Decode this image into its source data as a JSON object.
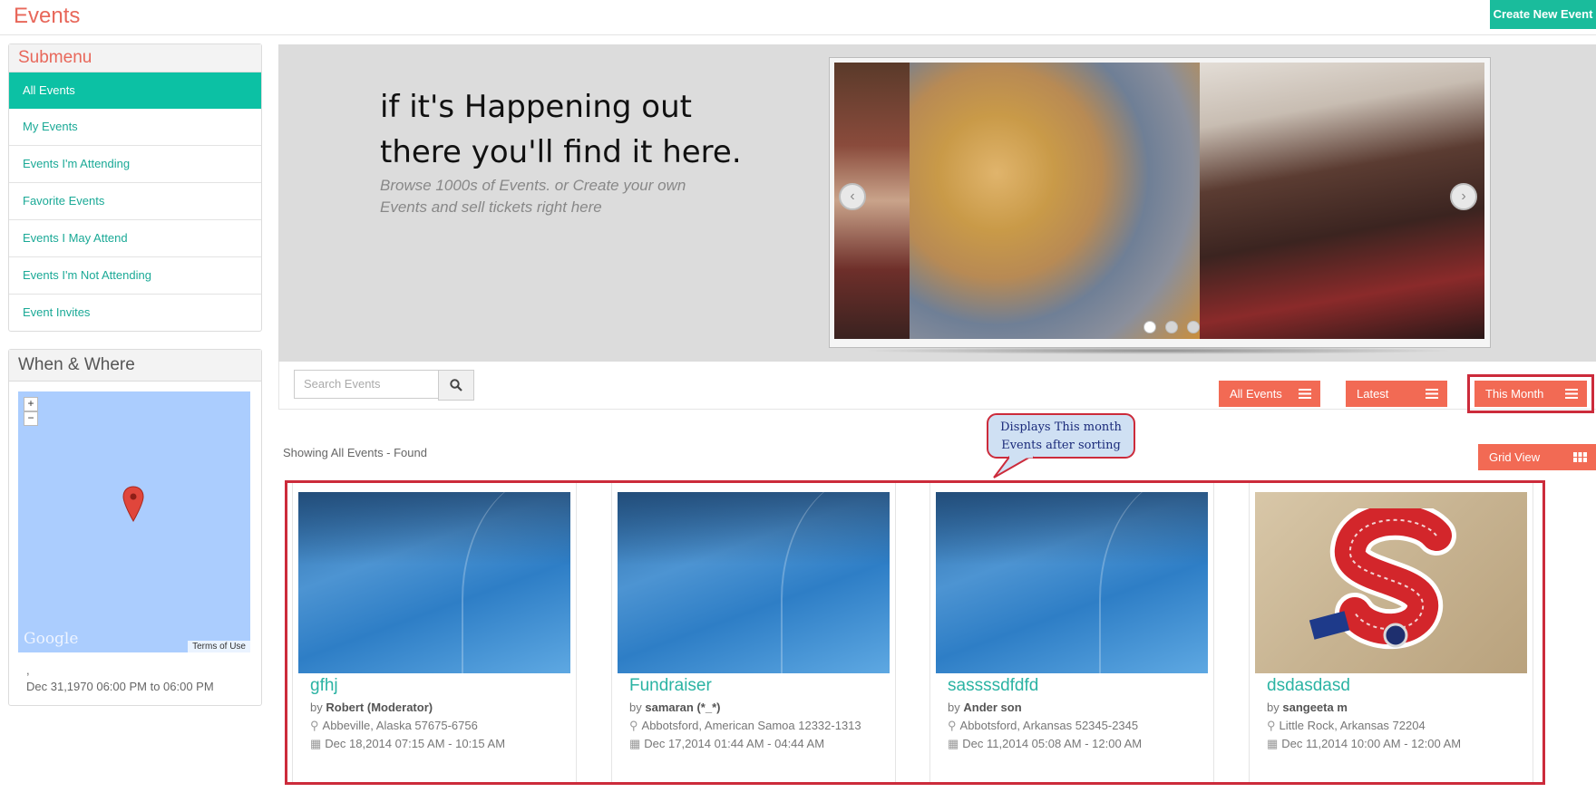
{
  "header": {
    "title": "Events",
    "create_label": "Create New Event"
  },
  "submenu": {
    "title": "Submenu",
    "items": [
      {
        "label": "All Events",
        "active": true
      },
      {
        "label": "My Events"
      },
      {
        "label": "Events I'm Attending"
      },
      {
        "label": "Favorite Events"
      },
      {
        "label": "Events I May Attend"
      },
      {
        "label": "Events I'm Not Attending"
      },
      {
        "label": "Event Invites"
      }
    ]
  },
  "when_where": {
    "title": "When & Where",
    "zoom_in": "+",
    "zoom_out": "−",
    "map_brand": "Google",
    "map_terms": "Terms of Use",
    "location_line": ",",
    "date_line": "Dec 31,1970 06:00 PM to 06:00 PM"
  },
  "hero": {
    "title": "if it's Happening out there you'll find it here.",
    "subtitle": "Browse 1000s of Events. or Create your own Events and sell tickets right here",
    "prev": "‹",
    "next": "›"
  },
  "toolbar": {
    "search_placeholder": "Search Events",
    "sort_all": "All Events",
    "sort_latest": "Latest",
    "sort_month": "This Month",
    "grid_view": "Grid View"
  },
  "callout": {
    "text": "Displays This month Events after sorting"
  },
  "results": {
    "showing": "Showing All Events - Found"
  },
  "cards": [
    {
      "title": "gfhj",
      "by": "by",
      "author": "Robert (Moderator)",
      "location": "Abbeville, Alaska 57675-6756",
      "date": "Dec 18,2014 07:15 AM - 10:15 AM"
    },
    {
      "title": "Fundraiser",
      "by": "by",
      "author": "samaran (*_*)",
      "location": "Abbotsford, American Samoa 12332-1313",
      "date": "Dec 17,2014 01:44 AM - 04:44 AM"
    },
    {
      "title": "sassssdfdfd",
      "by": "by",
      "author": "Ander son",
      "location": "Abbotsford, Arkansas 52345-2345",
      "date": "Dec 11,2014 05:08 AM - 12:00 AM"
    },
    {
      "title": "dsdasdasd",
      "by": "by",
      "author": "sangeeta m",
      "location": "Little Rock, Arkansas 72204",
      "date": "Dec 11,2014 10:00 AM - 12:00 AM"
    }
  ],
  "colors": {
    "accent": "#1abc9c",
    "brand": "#e8675a",
    "sort_button": "#f26a54",
    "highlight": "#cc2b3b"
  }
}
